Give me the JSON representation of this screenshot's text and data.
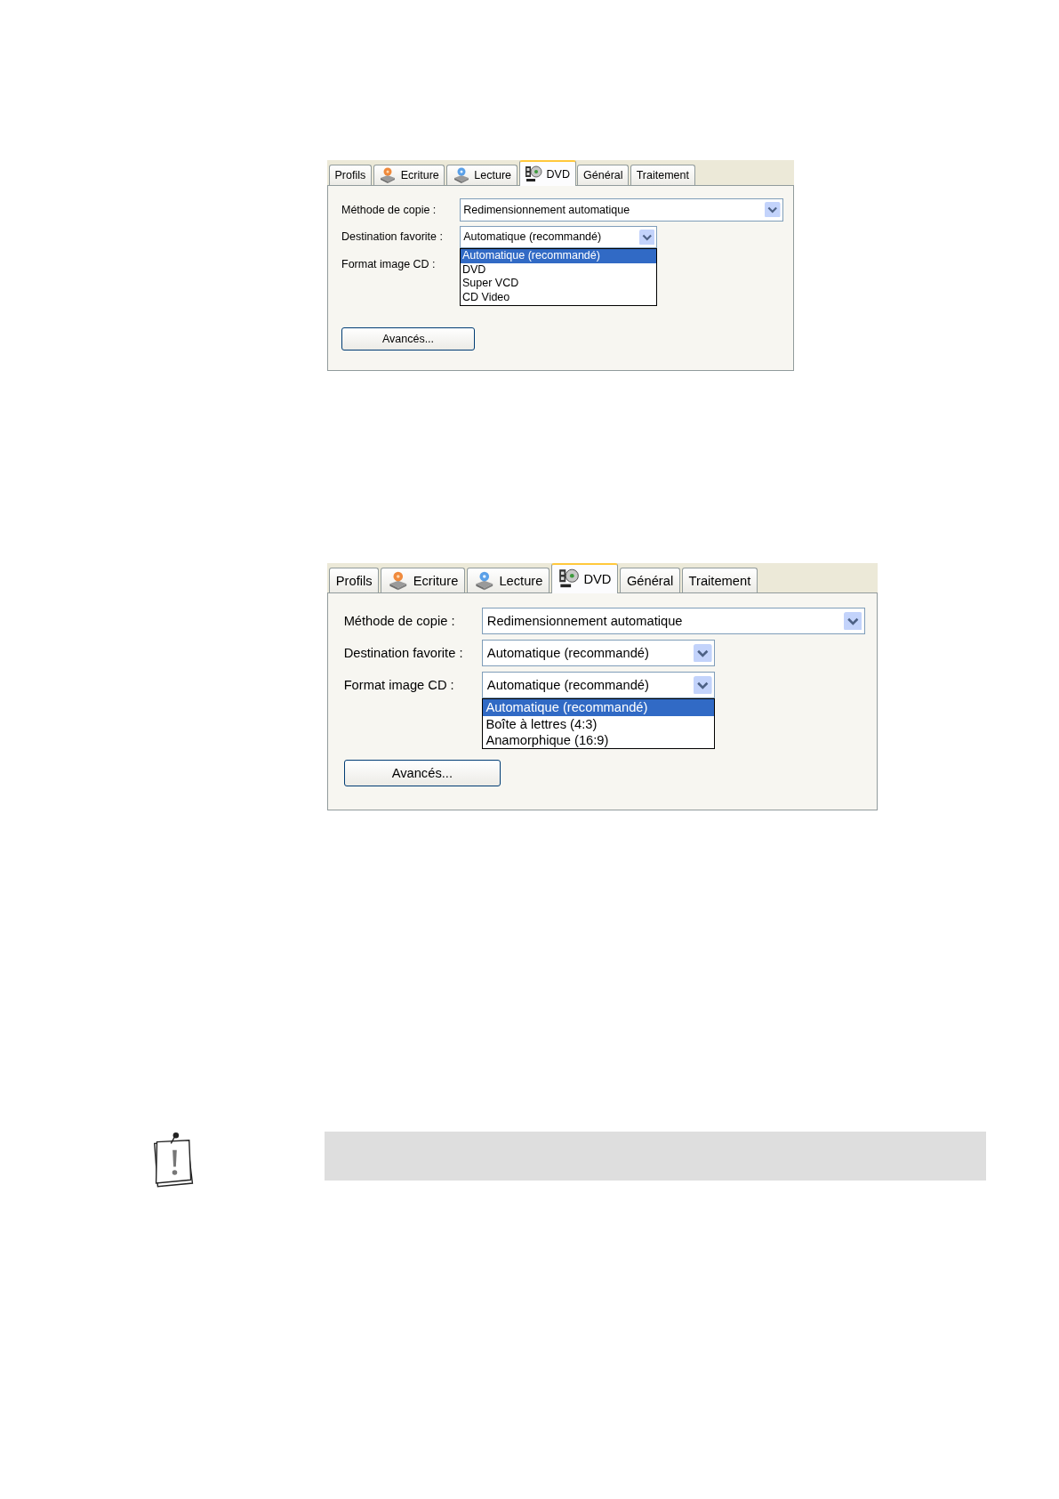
{
  "dialogs": [
    {
      "tabs": [
        {
          "label": "Profils",
          "kind": "plain",
          "selected": false
        },
        {
          "label": "Ecriture",
          "kind": "burn",
          "selected": false
        },
        {
          "label": "Lecture",
          "kind": "read",
          "selected": false
        },
        {
          "label": "DVD",
          "kind": "dvd",
          "selected": true
        },
        {
          "label": "Général",
          "kind": "plain",
          "selected": false
        },
        {
          "label": "Traitement",
          "kind": "plain",
          "selected": false
        }
      ],
      "fields": [
        {
          "label": "Méthode de copie :",
          "kind": "wide",
          "value": "Redimensionnement automatique"
        },
        {
          "label": "Destination favorite :",
          "kind": "narrow",
          "value": "Automatique (recommandé)",
          "options": [
            {
              "label": "Automatique (recommandé)",
              "selected": true
            },
            {
              "label": "DVD",
              "selected": false
            },
            {
              "label": "Super VCD",
              "selected": false
            },
            {
              "label": "CD Video",
              "selected": false
            }
          ]
        },
        {
          "label": "Format image CD :",
          "kind": "hidden"
        }
      ],
      "button": "Avancés..."
    },
    {
      "tabs": [
        {
          "label": "Profils",
          "kind": "plain",
          "selected": false
        },
        {
          "label": "Ecriture",
          "kind": "burn",
          "selected": false
        },
        {
          "label": "Lecture",
          "kind": "read",
          "selected": false
        },
        {
          "label": "DVD",
          "kind": "dvd",
          "selected": true
        },
        {
          "label": "Général",
          "kind": "plain",
          "selected": false
        },
        {
          "label": "Traitement",
          "kind": "plain",
          "selected": false
        }
      ],
      "fields": [
        {
          "label": "Méthode de copie :",
          "kind": "wide",
          "value": "Redimensionnement automatique"
        },
        {
          "label": "Destination favorite :",
          "kind": "narrow",
          "value": "Automatique (recommandé)"
        },
        {
          "label": "Format image CD :",
          "kind": "narrow",
          "value": "Automatique (recommandé)",
          "options": [
            {
              "label": "Automatique (recommandé)",
              "selected": true
            },
            {
              "label": "Boîte à lettres (4:3)",
              "selected": false
            },
            {
              "label": "Anamorphique (16:9)",
              "selected": false
            }
          ]
        }
      ],
      "button": "Avancés..."
    }
  ]
}
